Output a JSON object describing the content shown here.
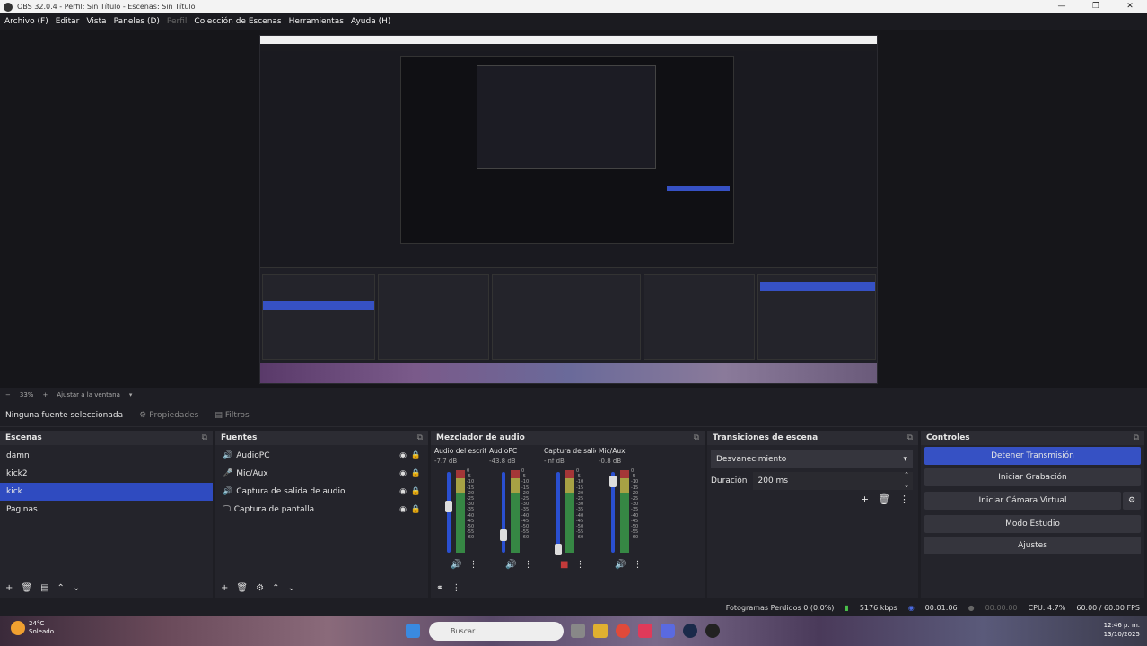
{
  "window": {
    "title": "OBS 32.0.4 - Perfil: Sin Título - Escenas: Sin Título",
    "controls": [
      "—",
      "❐",
      "✕"
    ]
  },
  "menu": {
    "items": [
      "Archivo (F)",
      "Editar",
      "Vista",
      "Paneles (D)",
      "Perfil",
      "Colección de Escenas",
      "Herramientas",
      "Ayuda (H)"
    ]
  },
  "zoom": {
    "level": "33%",
    "fit_label": "Ajustar a la ventana"
  },
  "source_bar": {
    "selection": "Ninguna fuente seleccionada",
    "properties": "Propiedades",
    "filters": "Filtros"
  },
  "scenes": {
    "title": "Escenas",
    "items": [
      "damn",
      "kick2",
      "kick",
      "Paginas"
    ],
    "selected_index": 2
  },
  "sources": {
    "title": "Fuentes",
    "items": [
      {
        "label": "AudioPC",
        "icon": "speaker-icon"
      },
      {
        "label": "Mic/Aux",
        "icon": "microphone-icon"
      },
      {
        "label": "Captura de salida de audio",
        "icon": "speaker-icon"
      },
      {
        "label": "Captura de pantalla",
        "icon": "monitor-icon"
      }
    ]
  },
  "mixer": {
    "title": "Mezclador de audio",
    "channels": [
      {
        "name": "Audio del escritorio",
        "db": "-7.7 dB",
        "level": 0.6
      },
      {
        "name": "AudioPC",
        "db": "-43.8 dB",
        "level": 0.2
      },
      {
        "name": "Captura de salida de audio",
        "db": "-inf dB",
        "level": 0.0
      },
      {
        "name": "Mic/Aux",
        "db": "-0.8 dB",
        "level": 0.95
      }
    ],
    "scale": [
      "0",
      "-5",
      "-10",
      "-15",
      "-20",
      "-25",
      "-30",
      "-35",
      "-40",
      "-45",
      "-50",
      "-55",
      "-60"
    ]
  },
  "transitions": {
    "title": "Transiciones de escena",
    "selected": "Desvanecimiento",
    "duration_label": "Duración",
    "duration_value": "200 ms"
  },
  "controls": {
    "title": "Controles",
    "buttons": [
      "Detener Transmisión",
      "Iniciar Grabación",
      "Iniciar Cámara Virtual",
      "Modo Estudio",
      "Ajustes"
    ]
  },
  "status": {
    "frames_dropped": "Fotogramas Perdidos 0 (0.0%)",
    "bitrate": "5176 kbps",
    "stream_time": "00:01:06",
    "rec_time": "00:00:00",
    "cpu": "CPU: 4.7%",
    "fps": "60.00 / 60.00 FPS"
  },
  "taskbar": {
    "temp": "24°C",
    "weather": "Soleado",
    "search": "Buscar",
    "time": "12:46 p. m.",
    "date": "13/10/2025"
  }
}
